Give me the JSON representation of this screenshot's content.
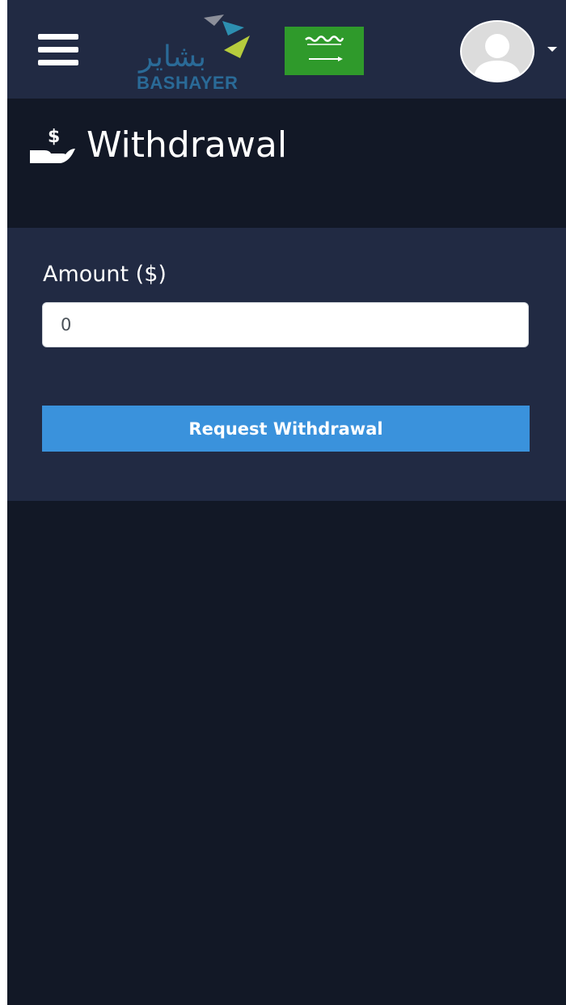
{
  "header": {
    "logo_arabic": "بشاير",
    "logo_text": "BASHAYER",
    "flag": "saudi-arabia-flag",
    "menu_icon": "hamburger-menu-icon",
    "avatar_icon": "user-avatar-icon",
    "dropdown_icon": "caret-down-icon"
  },
  "page": {
    "title": "Withdrawal",
    "title_icon": "hand-dollar-icon"
  },
  "form": {
    "amount_label": "Amount ($)",
    "amount_value": "0",
    "submit_label": "Request Withdrawal"
  },
  "colors": {
    "topbar": "#212a43",
    "background": "#121826",
    "card": "#212a43",
    "button": "#3a92dc"
  }
}
